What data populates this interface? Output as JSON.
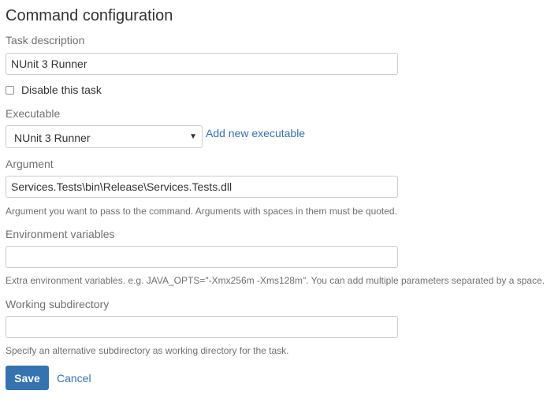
{
  "page": {
    "title": "Command configuration"
  },
  "task_description": {
    "label": "Task description",
    "value": "NUnit 3 Runner"
  },
  "disable_task": {
    "label": "Disable this task",
    "checked": false
  },
  "executable": {
    "label": "Executable",
    "selected": "NUnit 3 Runner",
    "add_link": "Add new executable"
  },
  "argument": {
    "label": "Argument",
    "value": "Services.Tests\\bin\\Release\\Services.Tests.dll",
    "help": "Argument you want to pass to the command. Arguments with spaces in them must be quoted."
  },
  "environment_variables": {
    "label": "Environment variables",
    "value": "",
    "help": "Extra environment variables. e.g. JAVA_OPTS=\"-Xmx256m -Xms128m\". You can add multiple parameters separated by a space."
  },
  "working_subdirectory": {
    "label": "Working subdirectory",
    "value": "",
    "help": "Specify an alternative subdirectory as working directory for the task."
  },
  "actions": {
    "save_label": "Save",
    "cancel_label": "Cancel"
  },
  "colors": {
    "primary": "#3572b0",
    "link": "#3572b0",
    "label": "#707070",
    "text": "#333333",
    "border": "#cccccc"
  },
  "icons": {
    "select_arrow": "triangle-down-icon"
  }
}
